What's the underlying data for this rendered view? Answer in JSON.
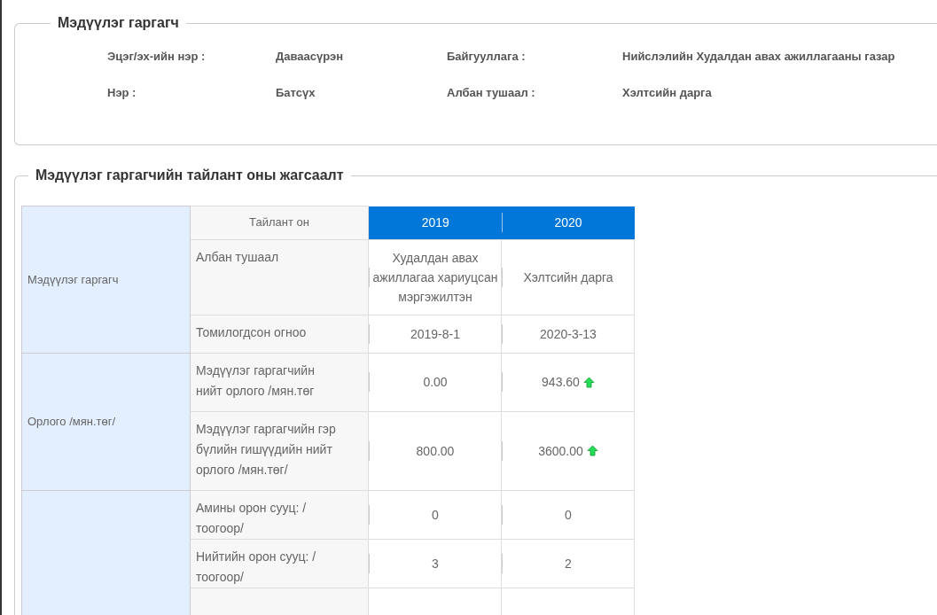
{
  "info_panel": {
    "title": "Мэдүүлэг гаргагч",
    "fields": [
      {
        "label": "Эцэг/эх-ийн нэр :",
        "value": "Даваасүрэн"
      },
      {
        "label": "Байгууллага :",
        "value": "Нийслэлийн Худалдан авах ажиллагааны газар"
      },
      {
        "label": "Нэр :",
        "value": "Батсүх"
      },
      {
        "label": "Албан тушаал :",
        "value": "Хэлтсийн дарга"
      }
    ]
  },
  "report_panel": {
    "title": "Мэдүүлэг гаргагчийн тайлант оны жагсаалт",
    "table": {
      "header_label": "Тайлант он",
      "years": [
        "2019",
        "2020"
      ],
      "groups": [
        {
          "label": "Мэдүүлэг гаргагч",
          "rows": [
            {
              "label": "Албан тушаал",
              "values": [
                {
                  "text": "Худалдан авах ажиллагаа хариуцсан мэргэжилтэн",
                  "up_arrow": false
                },
                {
                  "text": "Хэлтсийн дарга",
                  "up_arrow": false
                }
              ]
            },
            {
              "label": "Томилогдсон огноо",
              "values": [
                {
                  "text": "2019-8-1",
                  "up_arrow": false
                },
                {
                  "text": "2020-3-13",
                  "up_arrow": false
                }
              ]
            }
          ]
        },
        {
          "label": "Орлого /мян.төг/",
          "rows": [
            {
              "label": "Мэдүүлэг гаргагчийн нийт орлого /мян.төг",
              "values": [
                {
                  "text": "0.00",
                  "up_arrow": false
                },
                {
                  "text": "943.60",
                  "up_arrow": true
                }
              ]
            },
            {
              "label": "Мэдүүлэг гаргагчийн гэр бүлийн гишүүдийн нийт орлого /мян.төг/",
              "values": [
                {
                  "text": "800.00",
                  "up_arrow": false
                },
                {
                  "text": "3600.00",
                  "up_arrow": true
                }
              ]
            }
          ]
        },
        {
          "rows": [
            {
              "label": "Амины орон сууц: /тоогоор/",
              "values": [
                {
                  "text": "0",
                  "up_arrow": false
                },
                {
                  "text": "0",
                  "up_arrow": false
                }
              ]
            },
            {
              "label": "Нийтийн орон сууц: /тоогоор/",
              "values": [
                {
                  "text": "3",
                  "up_arrow": false
                },
                {
                  "text": "2",
                  "up_arrow": false
                }
              ]
            }
          ]
        }
      ]
    }
  }
}
